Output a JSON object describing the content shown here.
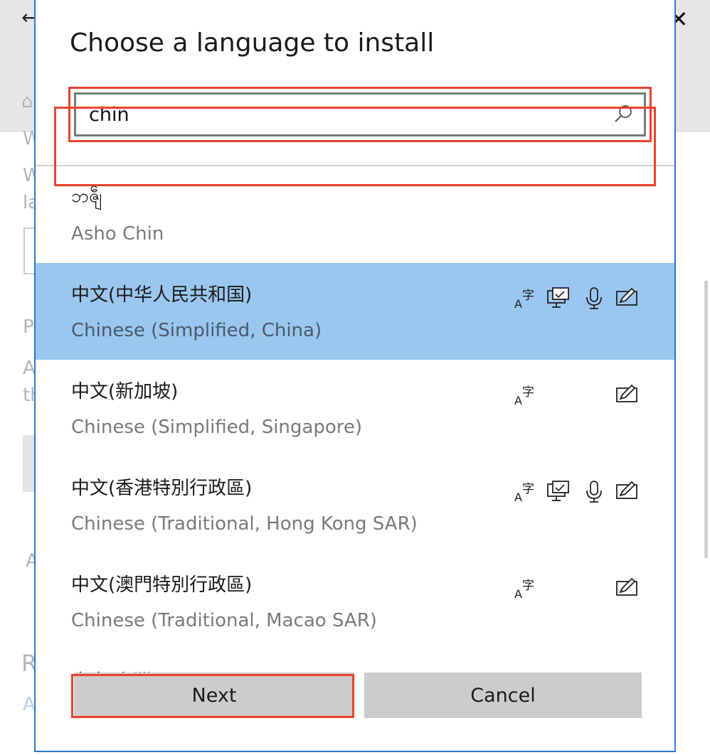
{
  "background": {
    "back_glyph": "←",
    "home_glyph": "⌂",
    "fragments": [
      "W",
      "W",
      "la",
      "P",
      "A",
      "th",
      "A",
      "R",
      "A"
    ]
  },
  "window_controls": {
    "close_glyph": "✕"
  },
  "dialog": {
    "title": "Choose a language to install",
    "search": {
      "value": "chin",
      "placeholder": ""
    },
    "languages": [
      {
        "native": "ဘၛဵ",
        "english": "Asho Chin",
        "selected": false,
        "features": []
      },
      {
        "native": "中文(中华人民共和国)",
        "english": "Chinese (Simplified, China)",
        "selected": true,
        "features": [
          "text-to-speech-icon",
          "display-language-icon",
          "speech-recognition-icon",
          "handwriting-icon"
        ]
      },
      {
        "native": "中文(新加坡)",
        "english": "Chinese (Simplified, Singapore)",
        "selected": false,
        "features": [
          "text-to-speech-icon",
          "handwriting-icon"
        ]
      },
      {
        "native": "中文(香港特別行政區)",
        "english": "Chinese (Traditional, Hong Kong SAR)",
        "selected": false,
        "features": [
          "text-to-speech-icon",
          "display-language-icon",
          "speech-recognition-icon",
          "handwriting-icon"
        ]
      },
      {
        "native": "中文(澳門特別行政區)",
        "english": "Chinese (Traditional, Macao SAR)",
        "selected": false,
        "features": [
          "text-to-speech-icon",
          "handwriting-icon"
        ]
      },
      {
        "native": "中文(台灣)",
        "english": "",
        "selected": false,
        "features": []
      }
    ],
    "buttons": {
      "next": "Next",
      "cancel": "Cancel"
    }
  },
  "colors": {
    "selection": "#99c7ef",
    "highlight_outline": "#e8442e",
    "dialog_border": "#2b79d6",
    "button_bg": "#cccccc"
  }
}
